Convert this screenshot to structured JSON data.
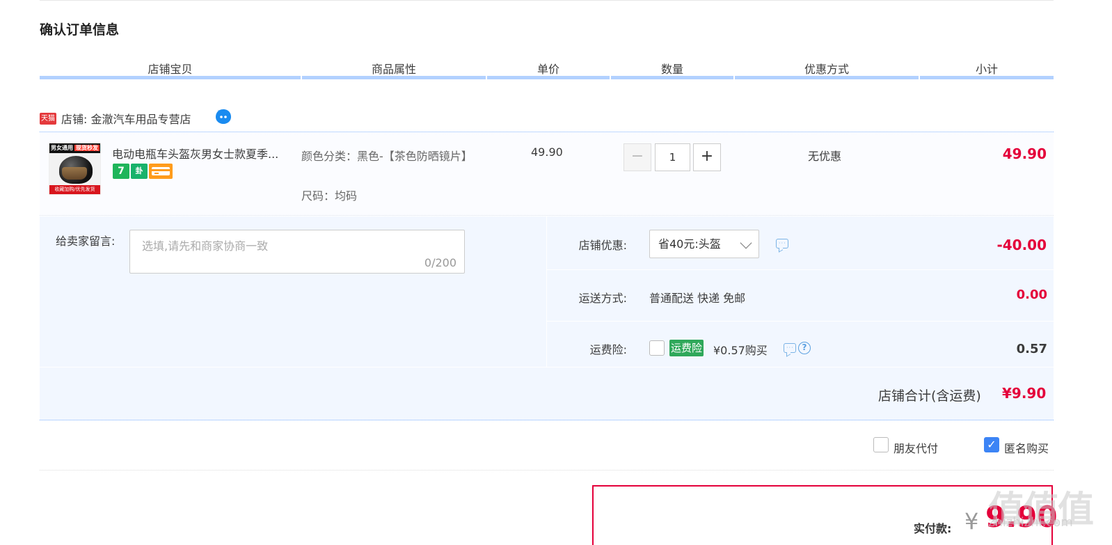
{
  "page_title": "确认订单信息",
  "columns": [
    "店铺宝贝",
    "商品属性",
    "单价",
    "数量",
    "优惠方式",
    "小计"
  ],
  "shop": {
    "badge_text": "天猫",
    "label": "店铺: 金澈汽车用品专营店"
  },
  "item": {
    "thumb_top_text": "男女通用",
    "thumb_top_tag": "现货秒发",
    "thumb_bottom_text": "收藏加购/优先发货",
    "title": "电动电瓶车头盔灰男女士款夏季...",
    "badges": [
      "7",
      "卦",
      ""
    ],
    "attr_color": "颜色分类：黑色-【茶色防晒镜片】",
    "attr_size": "尺码：均码",
    "unit_price": "49.90",
    "quantity": "1",
    "qty_minus": "−",
    "qty_plus": "+",
    "discount": "无优惠",
    "subtotal": "49.90"
  },
  "memo": {
    "label": "给卖家留言:",
    "placeholder": "选填,请先和商家协商一致",
    "count": "0/200"
  },
  "coupon": {
    "label": "店铺优惠:",
    "selected": "省40元:头盔",
    "amount": "-40.00"
  },
  "shipping": {
    "label": "运送方式:",
    "text": "普通配送 快递 免邮",
    "amount": "0.00"
  },
  "insurance": {
    "label": "运费险:",
    "tag": "运费险",
    "price": "¥0.57购买",
    "amount": "0.57"
  },
  "shop_total": {
    "label": "店铺合计(含运费)",
    "amount": "¥9.90"
  },
  "options": {
    "friend_pay": "朋友代付",
    "anonymous": "匿名购买"
  },
  "payment": {
    "label": "实付款:",
    "currency": "¥",
    "amount": "9.90"
  },
  "colors": {
    "accent_red": "#e4003a",
    "header_bar": "#b2d1ff",
    "panel_bg": "#f2f7ff",
    "check_blue": "#3c84f5",
    "insurance_green": "#2fa85a"
  },
  "watermark": {
    "glyphs": "值值值",
    "site": "zhizhizhi.com"
  }
}
